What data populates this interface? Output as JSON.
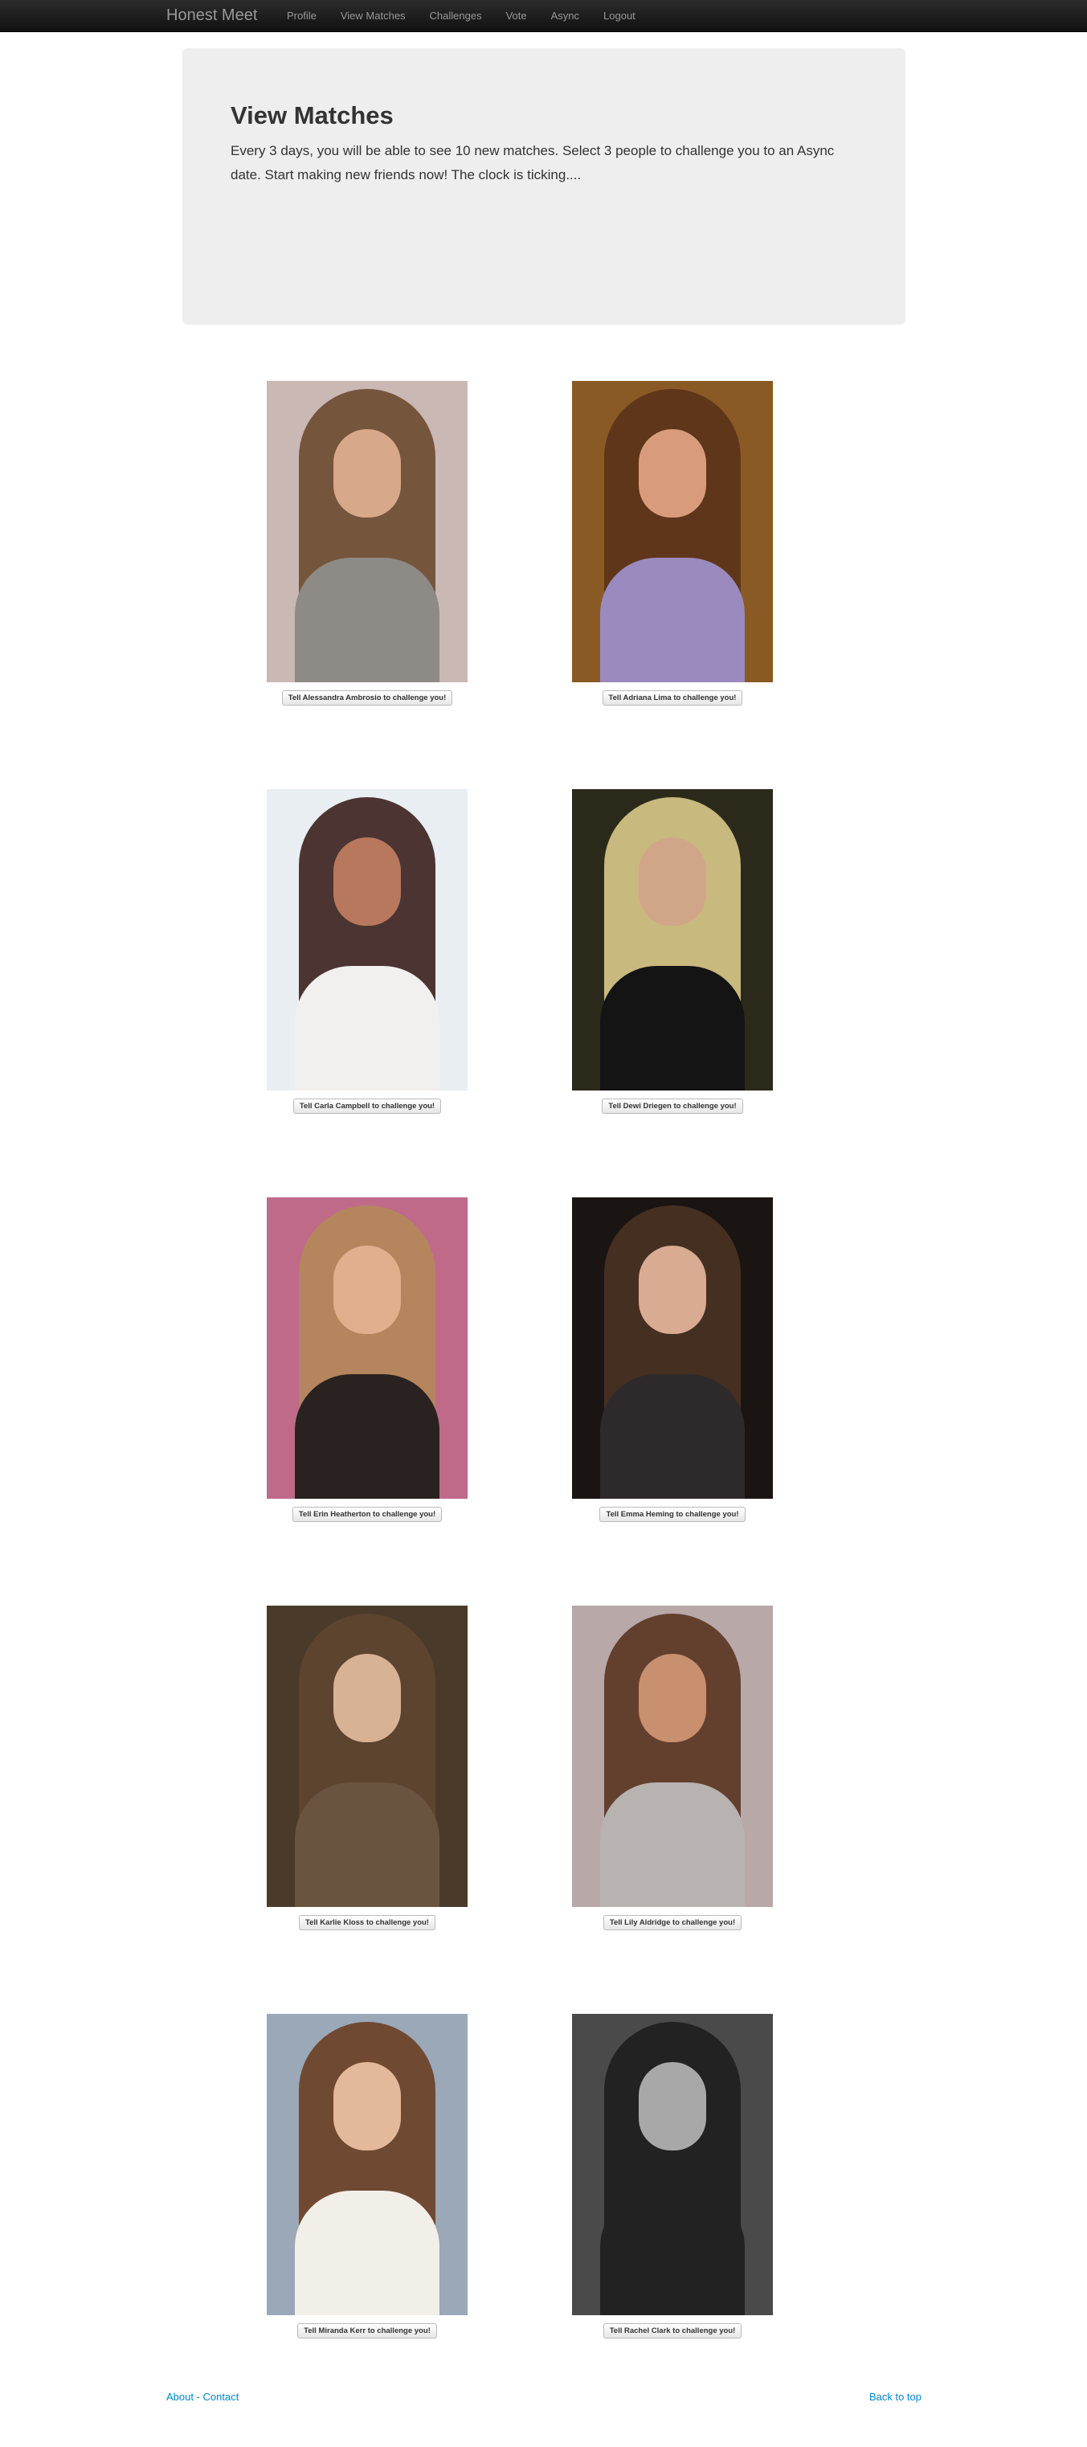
{
  "navbar": {
    "brand": "Honest Meet",
    "items": [
      {
        "label": "Profile"
      },
      {
        "label": "View Matches"
      },
      {
        "label": "Challenges"
      },
      {
        "label": "Vote"
      },
      {
        "label": "Async"
      },
      {
        "label": "Logout"
      }
    ]
  },
  "hero": {
    "title": "View Matches",
    "text": "Every 3 days, you will be able to see 10 new matches. Select 3 people to challenge you to an Async date. Start making new friends now! The clock is ticking...."
  },
  "matches": [
    {
      "button": "Tell Alessandra Ambrosio to challenge you!",
      "photo": {
        "bg": "#c9b8b4",
        "hair": "#6b4a2f",
        "skin": "#d8a88a",
        "top": "#8e8a86"
      }
    },
    {
      "button": "Tell Adriana Lima to challenge you!",
      "photo": {
        "bg": "#8a5a24",
        "hair": "#5a3218",
        "skin": "#d89c7c",
        "top": "#9a8ac0"
      }
    },
    {
      "button": "Tell Carla Campbell to challenge you!",
      "photo": {
        "bg": "#e9eef2",
        "hair": "#3a1f1c",
        "skin": "#b8785e",
        "top": "#f2f0ee"
      }
    },
    {
      "button": "Tell Dewi Driegen to challenge you!",
      "photo": {
        "bg": "#2b2a1a",
        "hair": "#d9c98a",
        "skin": "#d1a688",
        "top": "#141414"
      }
    },
    {
      "button": "Tell Erin Heatherton to challenge you!",
      "photo": {
        "bg": "#c06a8a",
        "hair": "#b48a58",
        "skin": "#e0b08e",
        "top": "#2a2220"
      }
    },
    {
      "button": "Tell Emma Heming to challenge you!",
      "photo": {
        "bg": "#1a1412",
        "hair": "#4a3224",
        "skin": "#d8ab92",
        "top": "#2e2a2c"
      }
    },
    {
      "button": "Tell Karlie Kloss to challenge you!",
      "photo": {
        "bg": "#4a3a2a",
        "hair": "#5e4630",
        "skin": "#d8b294",
        "top": "#6a5440"
      }
    },
    {
      "button": "Tell Lily Aldridge to challenge you!",
      "photo": {
        "bg": "#b8a8a8",
        "hair": "#5a3420",
        "skin": "#c8906e",
        "top": "#b8b2b0"
      }
    },
    {
      "button": "Tell Miranda Kerr to challenge you!",
      "photo": {
        "bg": "#9aa8b8",
        "hair": "#6a3e22",
        "skin": "#e4b89a",
        "top": "#f2efe8"
      }
    },
    {
      "button": "Tell Rachel Clark to challenge you!",
      "photo": {
        "bg": "#4a4a4a",
        "hair": "#1e1e1e",
        "skin": "#a8a8a8",
        "top": "#222222"
      }
    }
  ],
  "footer": {
    "about": "About",
    "separator": " - ",
    "contact": "Contact",
    "back_to_top": "Back to top"
  }
}
